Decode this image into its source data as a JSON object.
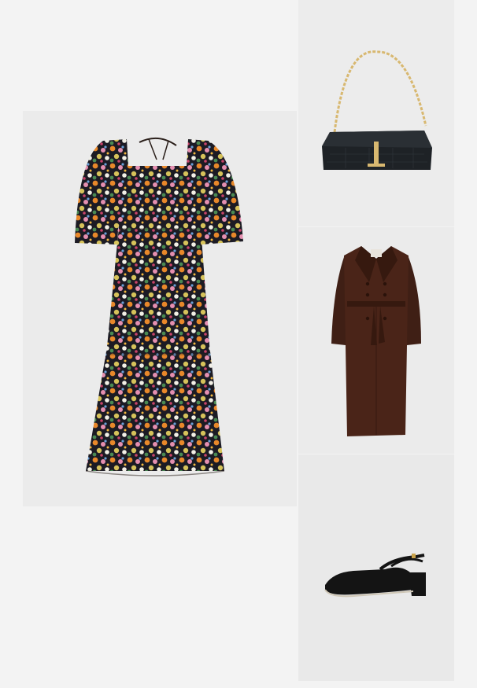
{
  "outfit": {
    "background_color": "#f3f3f3",
    "tile_color": "#ebebeb",
    "items": [
      {
        "id": "dress",
        "icon": "floral-midi-dress-image",
        "colors": [
          "#1a1a22",
          "#e8882a",
          "#d6c25a",
          "#e58fb0",
          "#4a8a52"
        ]
      },
      {
        "id": "bag",
        "icon": "black-croc-shoulder-bag-image",
        "colors": [
          "#1e2226",
          "#d8b870"
        ]
      },
      {
        "id": "coat",
        "icon": "brown-trench-coat-image",
        "colors": [
          "#4a2418",
          "#36190f"
        ]
      },
      {
        "id": "shoe",
        "icon": "black-slingback-shoe-image",
        "colors": [
          "#141414"
        ]
      }
    ]
  }
}
